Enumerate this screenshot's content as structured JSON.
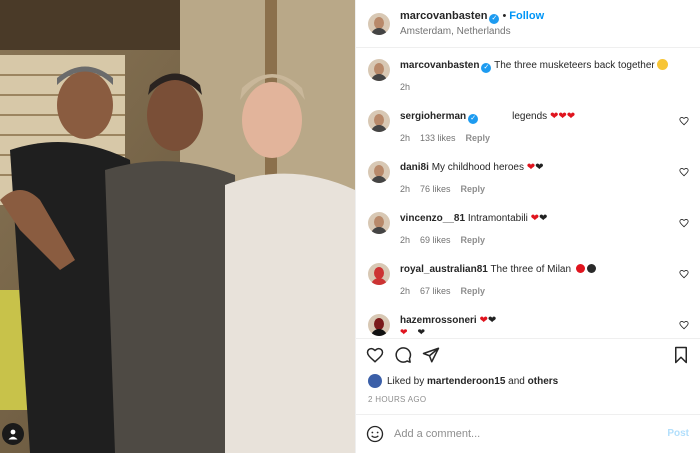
{
  "post": {
    "author": "marcovanbasten",
    "follow_label": "Follow",
    "separator": "•",
    "location": "Amsterdam, Netherlands",
    "caption_author": "marcovanbasten",
    "caption": "The three musketeers back together",
    "caption_time": "2h",
    "verified_mark": "✓"
  },
  "comments": [
    {
      "user": "sergioherman",
      "verified": true,
      "text": "legends",
      "emoji": [
        "heart-red",
        "heart-red",
        "heart-red"
      ],
      "time": "2h",
      "likes": "133 likes",
      "reply": "Reply"
    },
    {
      "user": "dani8i",
      "verified": false,
      "text": "My childhood heroes",
      "emoji": [
        "heart-red",
        "heart-black"
      ],
      "time": "2h",
      "likes": "76 likes",
      "reply": "Reply"
    },
    {
      "user": "vincenzo__81",
      "verified": false,
      "text": "Intramontabili",
      "emoji": [
        "heart-red",
        "heart-black"
      ],
      "time": "2h",
      "likes": "69 likes",
      "reply": "Reply"
    },
    {
      "user": "royal_australian81",
      "verified": false,
      "text": "The three of Milan",
      "emoji": [
        "circle-red",
        "circle-black"
      ],
      "time": "2h",
      "likes": "67 likes",
      "reply": "Reply"
    },
    {
      "user": "hazemrossoneri",
      "verified": false,
      "text": "",
      "emoji": [
        "heart-red",
        "heart-black"
      ],
      "time": "",
      "likes": "",
      "reply": ""
    }
  ],
  "likes": {
    "prefix": "Liked by",
    "user": "martenderoon15",
    "and": "and",
    "others": "others"
  },
  "time_ago": "2 HOURS AGO",
  "add_comment": {
    "placeholder": "Add a comment...",
    "post_label": "Post"
  },
  "icons": {
    "like": "heart-outline-icon",
    "comment": "comment-icon",
    "share": "share-icon",
    "save": "bookmark-icon",
    "emoji": "emoji-icon",
    "user_tag": "user-tag-icon"
  },
  "colors": {
    "follow": "#0095f6",
    "verified": "#1d9bf0",
    "heart_red": "#e0141e",
    "post_disabled": "#b2dffc"
  }
}
